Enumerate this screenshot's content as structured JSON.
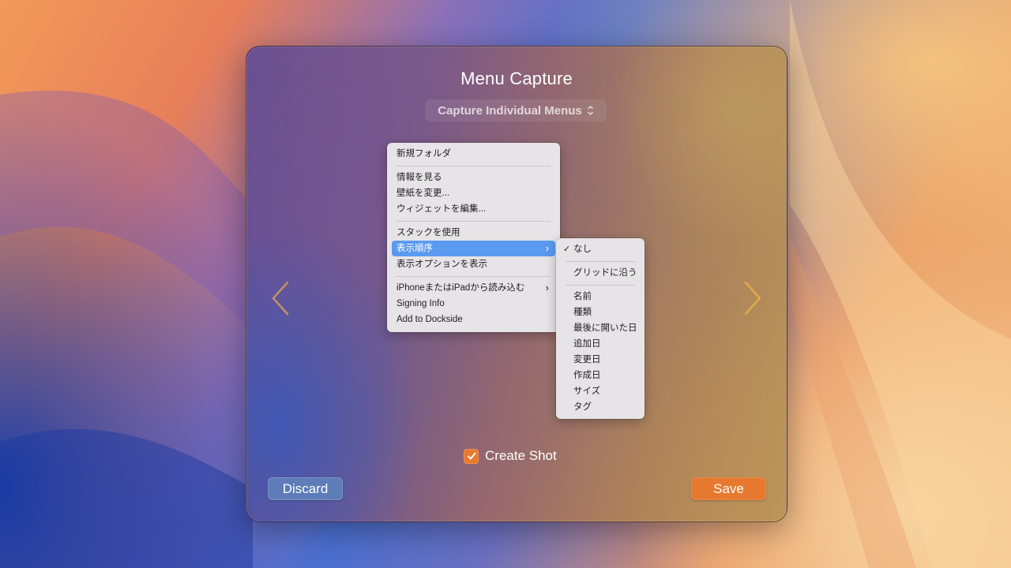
{
  "panel": {
    "title": "Menu Capture",
    "mode_select": {
      "value": "Capture Individual Menus",
      "icon": "chevron-updown-icon"
    },
    "nav": {
      "prev_icon": "chevron-left-icon",
      "next_icon": "chevron-right-icon",
      "accent_color": "#e3a74c"
    }
  },
  "context_menu": {
    "groups": [
      {
        "items": [
          {
            "label": "新規フォルダ"
          }
        ]
      },
      {
        "items": [
          {
            "label": "情報を見る"
          },
          {
            "label": "壁紙を変更..."
          },
          {
            "label": "ウィジェットを編集..."
          }
        ]
      },
      {
        "items": [
          {
            "label": "スタックを使用"
          },
          {
            "label": "表示順序",
            "highlighted": true,
            "submenu": true
          },
          {
            "label": "表示オプションを表示"
          }
        ]
      },
      {
        "items": [
          {
            "label": "iPhoneまたはiPadから読み込む",
            "submenu": true
          },
          {
            "label": "Signing Info"
          },
          {
            "label": "Add to Dockside"
          }
        ]
      }
    ],
    "highlight_color": "#5a9af0"
  },
  "submenu": {
    "groups": [
      {
        "items": [
          {
            "label": "なし",
            "checked": true
          }
        ]
      },
      {
        "items": [
          {
            "label": "グリッドに沿う"
          }
        ]
      },
      {
        "items": [
          {
            "label": "名前"
          },
          {
            "label": "種類"
          },
          {
            "label": "最後に開いた日"
          },
          {
            "label": "追加日"
          },
          {
            "label": "変更日"
          },
          {
            "label": "作成日"
          },
          {
            "label": "サイズ"
          },
          {
            "label": "タグ"
          }
        ]
      }
    ]
  },
  "create_shot": {
    "label": "Create Shot",
    "checked": true
  },
  "buttons": {
    "discard": "Discard",
    "save": "Save",
    "save_color": "#e6792f",
    "discard_color": "#5d7cb8"
  }
}
